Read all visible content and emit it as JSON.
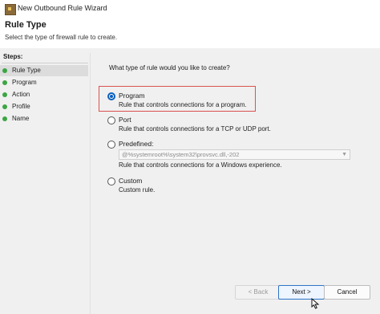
{
  "window": {
    "title": "New Outbound Rule Wizard"
  },
  "header": {
    "title": "Rule Type",
    "subtitle": "Select the type of firewall rule to create."
  },
  "steps": {
    "label": "Steps:",
    "items": [
      {
        "label": "Rule Type",
        "current": true
      },
      {
        "label": "Program"
      },
      {
        "label": "Action"
      },
      {
        "label": "Profile"
      },
      {
        "label": "Name"
      }
    ]
  },
  "main": {
    "question": "What type of rule would you like to create?",
    "options": [
      {
        "label": "Program",
        "description": "Rule that controls connections for a program.",
        "selected": true
      },
      {
        "label": "Port",
        "description": "Rule that controls connections for a TCP or UDP port."
      },
      {
        "label": "Predefined:",
        "select_value": "@%systemroot%\\system32\\provsvc.dll,-202",
        "description": "Rule that controls connections for a Windows experience."
      },
      {
        "label": "Custom",
        "description": "Custom rule."
      }
    ]
  },
  "footer": {
    "back_label": "< Back",
    "next_label": "Next >",
    "cancel_label": "Cancel"
  },
  "colors": {
    "accent": "#0a5fbf",
    "step_dot": "#3ca544",
    "highlight_border": "#d9534f"
  }
}
